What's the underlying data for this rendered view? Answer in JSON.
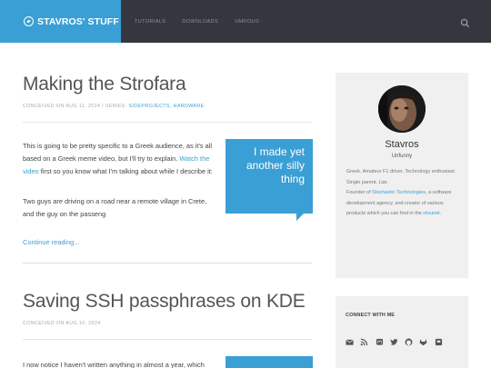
{
  "header": {
    "logo_text": "STAVROS' STUFF",
    "nav": [
      "TUTORIALS",
      "DOWNLOADS",
      "VARIOUS"
    ]
  },
  "posts": [
    {
      "title": "Making the Strofara",
      "meta_prefix": "CONCEIVED ON AUG 11, 2024 / SERIES: ",
      "categories": "SIDEPROJECTS, HARDWARE",
      "p1_a": "This is going to be pretty specific to a Greek audience, as it's all based on a Greek meme video, but I'll try to explain. ",
      "p1_link": "Watch the video",
      "p1_b": " first so you know what I'm talking about while I describe it:",
      "p2": "Two guys are driving on a road near a remote village in Crete, and the guy on the passeng",
      "callout": "I made yet another silly thing",
      "continue": "Continue reading..."
    },
    {
      "title": "Saving SSH passphrases on KDE",
      "meta": "CONCEIVED ON AUG 10, 2024",
      "p1": "I now notice I haven't written anything in almost a year, which"
    }
  ],
  "sidebar": {
    "name": "Stavros",
    "tagline": "Unfunny",
    "bio_1": "Greek. Amateur F1 driver. Technology enthusiast. Single parent. Liar.",
    "bio_2a": "Founder of ",
    "bio_2_link": "Stochastic Technologies",
    "bio_2b": ", a software development agency, and creator of various products which you can find in the ",
    "bio_2_link2": "résumé",
    "bio_2c": ".",
    "connect_title": "CONNECT WITH ME",
    "social_icons": [
      "email-icon",
      "rss-icon",
      "mastodon-icon",
      "twitter-icon",
      "github-icon",
      "gitlab-icon",
      "blog-icon"
    ]
  },
  "colors": {
    "accent": "#3a9fd5",
    "header_bg": "#34373d",
    "sidebar_bg": "#f0f0f0"
  }
}
